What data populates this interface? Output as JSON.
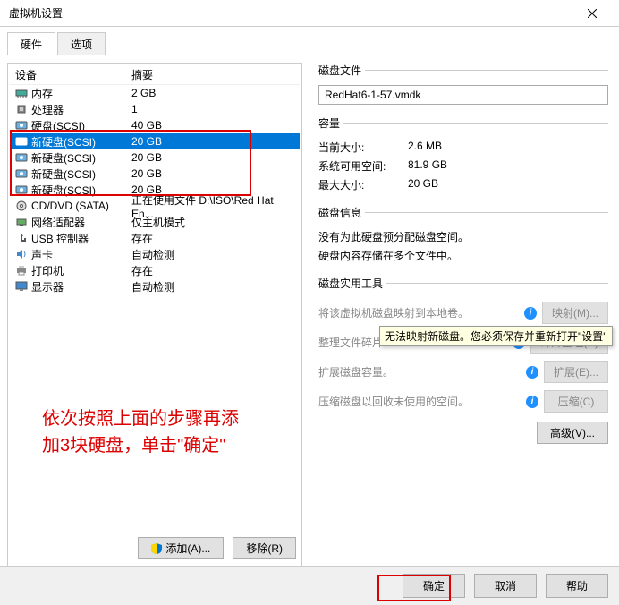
{
  "window": {
    "title": "虚拟机设置"
  },
  "tabs": {
    "hardware": "硬件",
    "options": "选项"
  },
  "device_header": {
    "col_device": "设备",
    "col_summary": "摘要"
  },
  "devices": [
    {
      "name": "内存",
      "summary": "2 GB",
      "icon": "memory"
    },
    {
      "name": "处理器",
      "summary": "1",
      "icon": "cpu"
    },
    {
      "name": "硬盘(SCSI)",
      "summary": "40 GB",
      "icon": "disk"
    },
    {
      "name": "新硬盘(SCSI)",
      "summary": "20 GB",
      "icon": "disk",
      "selected": true
    },
    {
      "name": "新硬盘(SCSI)",
      "summary": "20 GB",
      "icon": "disk"
    },
    {
      "name": "新硬盘(SCSI)",
      "summary": "20 GB",
      "icon": "disk"
    },
    {
      "name": "新硬盘(SCSI)",
      "summary": "20 GB",
      "icon": "disk"
    },
    {
      "name": "CD/DVD (SATA)",
      "summary": "正在使用文件 D:\\ISO\\Red Hat En...",
      "icon": "cdrom"
    },
    {
      "name": "网络适配器",
      "summary": "仅主机模式",
      "icon": "network"
    },
    {
      "name": "USB 控制器",
      "summary": "存在",
      "icon": "usb"
    },
    {
      "name": "声卡",
      "summary": "自动检测",
      "icon": "sound"
    },
    {
      "name": "打印机",
      "summary": "存在",
      "icon": "printer"
    },
    {
      "name": "显示器",
      "summary": "自动检测",
      "icon": "display"
    }
  ],
  "annotation": {
    "line1": "依次按照上面的步骤再添",
    "line2": "加3块硬盘，单击\"确定\""
  },
  "left_buttons": {
    "add": "添加(A)...",
    "remove": "移除(R)"
  },
  "disk_file": {
    "legend": "磁盘文件",
    "value": "RedHat6-1-57.vmdk"
  },
  "capacity": {
    "legend": "容量",
    "current_label": "当前大小:",
    "current_value": "2.6 MB",
    "free_label": "系统可用空间:",
    "free_value": "81.9 GB",
    "max_label": "最大大小:",
    "max_value": "20 GB"
  },
  "disk_info": {
    "legend": "磁盘信息",
    "line1": "没有为此硬盘预分配磁盘空间。",
    "line2": "硬盘内容存储在多个文件中。"
  },
  "disk_util": {
    "legend": "磁盘实用工具",
    "map_text": "将该虚拟机磁盘映射到本地卷。",
    "map_btn": "映射(M)...",
    "defrag_text": "整理文件碎片",
    "defrag_btn": "碎片整理(D)",
    "expand_text": "扩展磁盘容量。",
    "expand_btn": "扩展(E)...",
    "compact_text": "压缩磁盘以回收未使用的空间。",
    "compact_btn": "压缩(C)",
    "advanced_btn": "高级(V)..."
  },
  "tooltip": "无法映射新磁盘。您必须保存并重新打开\"设置\"",
  "bottom": {
    "ok": "确定",
    "cancel": "取消",
    "help": "帮助"
  }
}
